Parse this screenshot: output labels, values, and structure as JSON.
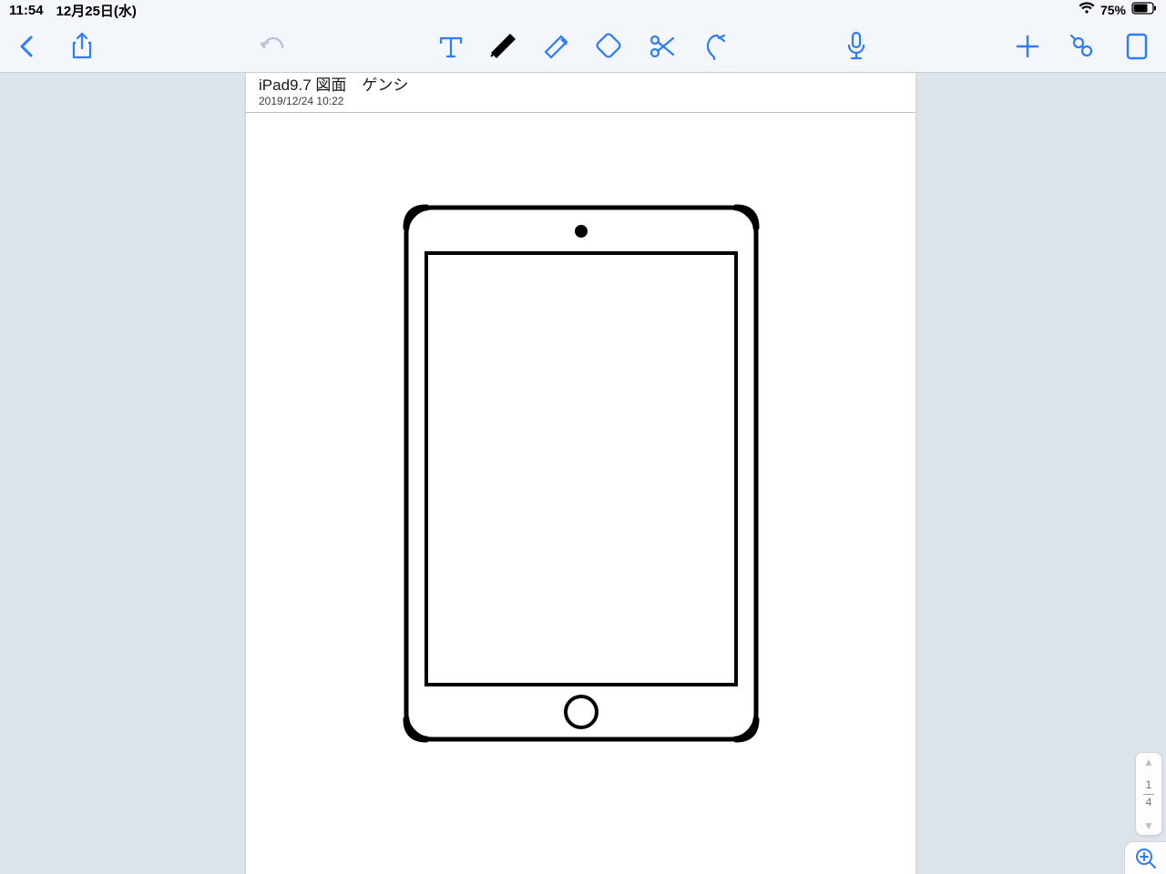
{
  "status": {
    "time": "11:54",
    "date": "12月25日(水)",
    "battery_pct": "75%"
  },
  "note": {
    "title": "iPad9.7 図面　ゲンシ",
    "timestamp": "2019/12/24 10:22"
  },
  "pagenav": {
    "current": "1",
    "total": "4"
  },
  "colors": {
    "accent": "#2f7bff"
  }
}
